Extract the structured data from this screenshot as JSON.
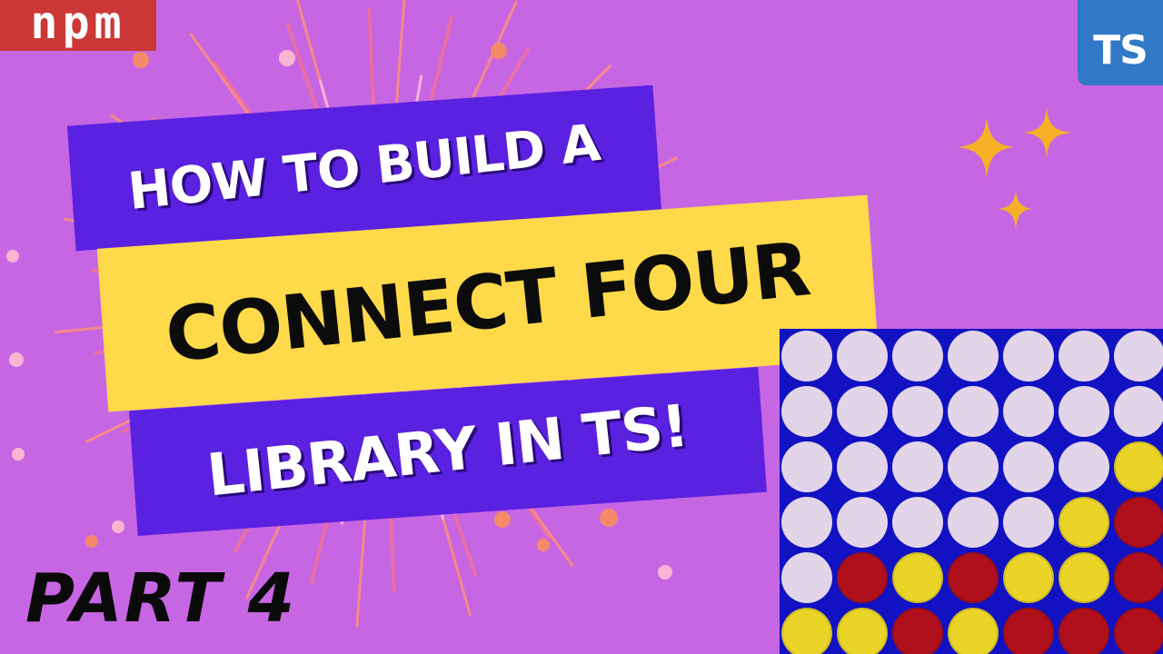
{
  "logos": {
    "npm": "npm",
    "ts": "TS"
  },
  "title": {
    "line1": "HOW TO BUILD A",
    "line2": "CONNECT FOUR",
    "line3": "LIBRARY IN TS!"
  },
  "part_label": "PART 4",
  "colors": {
    "background": "#c766e3",
    "banner_purple": "#5b21e0",
    "banner_yellow": "#fed94a",
    "board_blue": "#1212c2",
    "empty_slot": "#e2d5e8",
    "yellow_disc": "#ead428",
    "red_disc": "#b0101c",
    "sparkle": "#f5b026"
  },
  "board": {
    "rows": [
      [
        "empty",
        "empty",
        "empty",
        "empty",
        "empty",
        "empty",
        "empty"
      ],
      [
        "empty",
        "empty",
        "empty",
        "empty",
        "empty",
        "empty",
        "empty"
      ],
      [
        "empty",
        "empty",
        "empty",
        "empty",
        "empty",
        "empty",
        "yellow"
      ],
      [
        "empty",
        "empty",
        "empty",
        "empty",
        "empty",
        "yellow",
        "red"
      ],
      [
        "empty",
        "red",
        "yellow",
        "red",
        "yellow",
        "yellow",
        "red"
      ],
      [
        "yellow",
        "yellow",
        "red",
        "yellow",
        "red",
        "red",
        "red"
      ]
    ]
  }
}
